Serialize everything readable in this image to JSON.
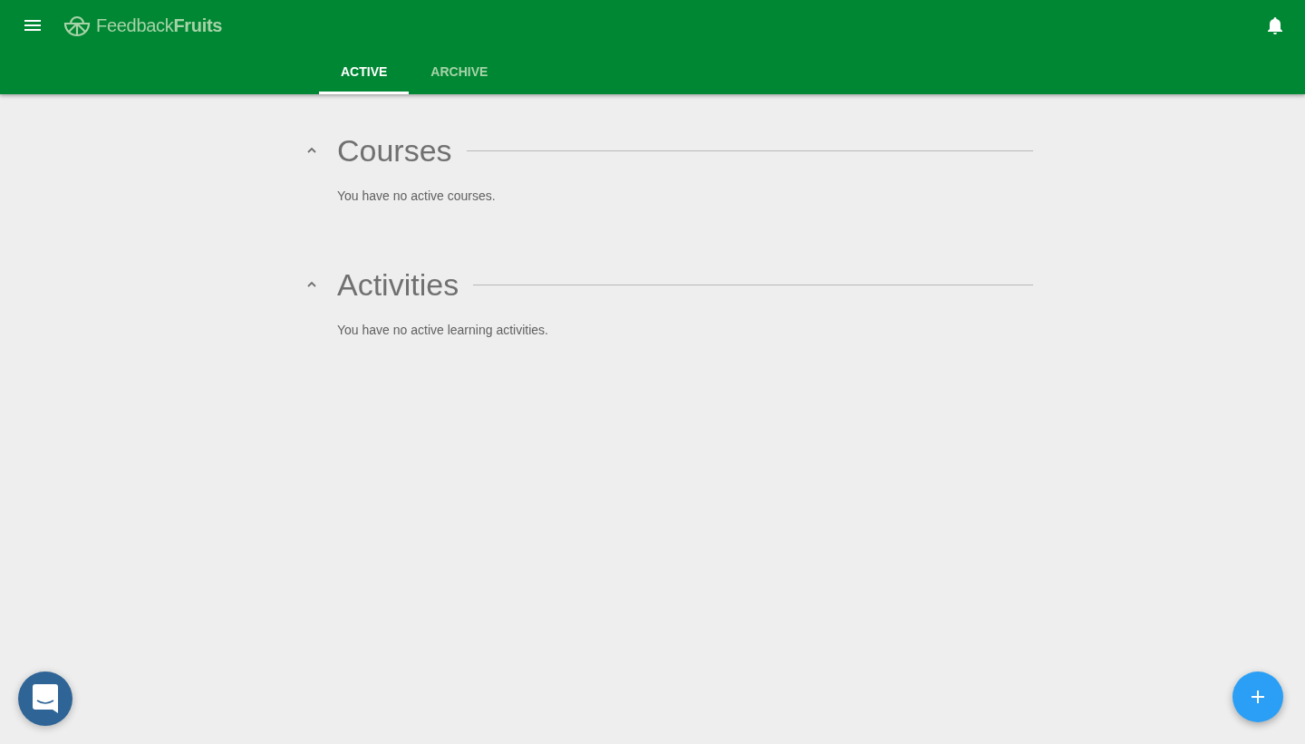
{
  "header": {
    "logo": "Feedback**Fruits**"
  },
  "tabs": [
    {
      "label": "ACTIVE",
      "selected": true
    },
    {
      "label": "ARCHIVE",
      "selected": false
    }
  ],
  "sections": [
    {
      "title": "Courses",
      "expanded": true,
      "message": "You have no active courses."
    },
    {
      "title": "Activities",
      "expanded": true,
      "message": "You have no active learning activities."
    }
  ]
}
